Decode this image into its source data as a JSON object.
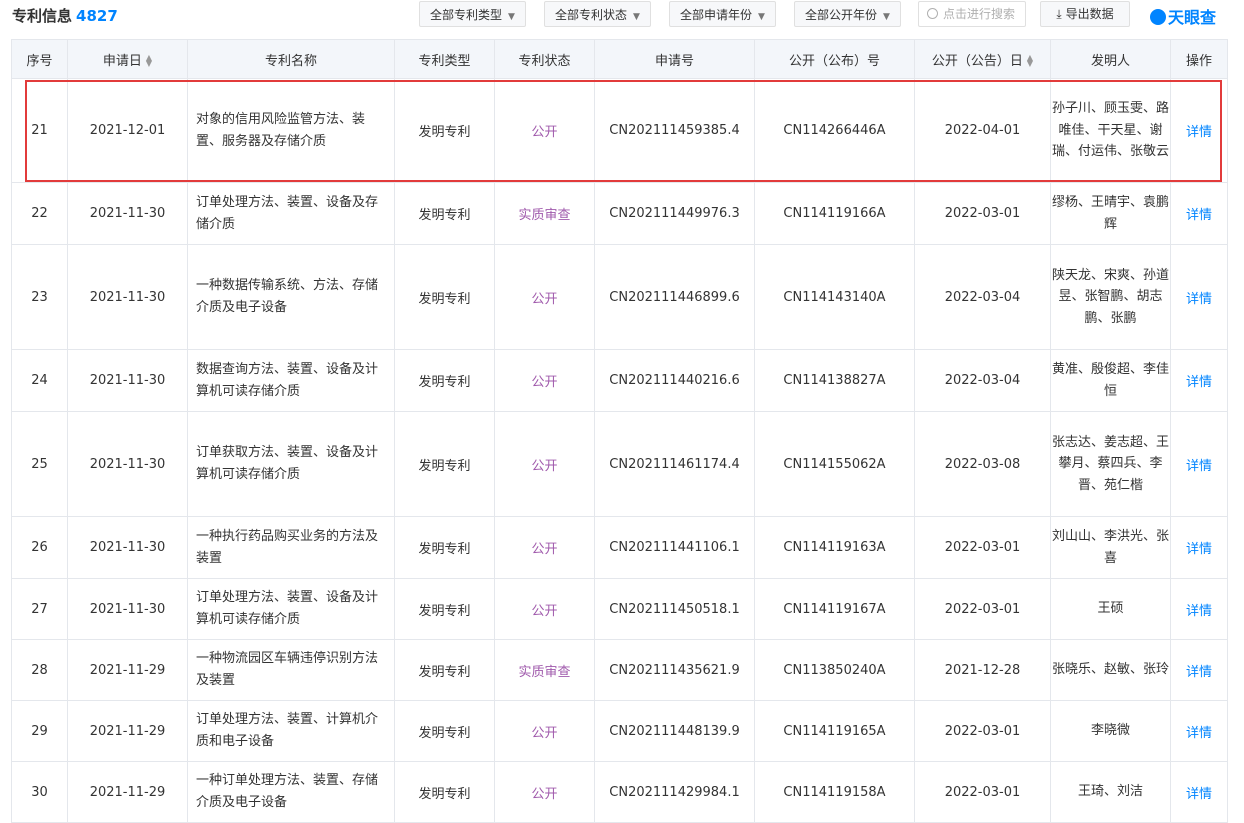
{
  "header": {
    "title": "专利信息",
    "count": "4827",
    "filters": [
      "全部专利类型",
      "全部专利状态",
      "全部申请年份",
      "全部公开年份"
    ],
    "search_placeholder": "点击进行搜索",
    "export_label": "导出数据",
    "logo_text": "天眼查"
  },
  "colors": {
    "accent": "#0084ff",
    "status": "#a05aac",
    "highlight": "#e23b3b"
  },
  "table": {
    "columns": [
      "序号",
      "申请日",
      "专利名称",
      "专利类型",
      "专利状态",
      "申请号",
      "公开（公布）号",
      "公开（公告）日",
      "发明人",
      "操作"
    ],
    "rows": [
      {
        "no": "21",
        "date": "2021-12-01",
        "name": "对象的信用风险监管方法、装置、服务器及存储介质",
        "type": "发明专利",
        "status": "公开",
        "app_no": "CN202111459385.4",
        "pub_no": "CN114266446A",
        "pub_date": "2022-04-01",
        "inventors": "孙子川、顾玉雯、路唯佳、干天星、谢瑞、付运伟、张敬云",
        "action": "详情"
      },
      {
        "no": "22",
        "date": "2021-11-30",
        "name": "订单处理方法、装置、设备及存储介质",
        "type": "发明专利",
        "status": "实质审查",
        "app_no": "CN202111449976.3",
        "pub_no": "CN114119166A",
        "pub_date": "2022-03-01",
        "inventors": "缪杨、王晴宇、袁鹏辉",
        "action": "详情"
      },
      {
        "no": "23",
        "date": "2021-11-30",
        "name": "一种数据传输系统、方法、存储介质及电子设备",
        "type": "发明专利",
        "status": "公开",
        "app_no": "CN202111446899.6",
        "pub_no": "CN114143140A",
        "pub_date": "2022-03-04",
        "inventors": "陕天龙、宋爽、孙道昱、张智鹏、胡志鹏、张鹏",
        "action": "详情"
      },
      {
        "no": "24",
        "date": "2021-11-30",
        "name": "数据查询方法、装置、设备及计算机可读存储介质",
        "type": "发明专利",
        "status": "公开",
        "app_no": "CN202111440216.6",
        "pub_no": "CN114138827A",
        "pub_date": "2022-03-04",
        "inventors": "黄准、殷俊超、李佳恒",
        "action": "详情"
      },
      {
        "no": "25",
        "date": "2021-11-30",
        "name": "订单获取方法、装置、设备及计算机可读存储介质",
        "type": "发明专利",
        "status": "公开",
        "app_no": "CN202111461174.4",
        "pub_no": "CN114155062A",
        "pub_date": "2022-03-08",
        "inventors": "张志达、姜志超、王攀月、蔡四兵、李晋、苑仁楷",
        "action": "详情"
      },
      {
        "no": "26",
        "date": "2021-11-30",
        "name": "一种执行药品购买业务的方法及装置",
        "type": "发明专利",
        "status": "公开",
        "app_no": "CN202111441106.1",
        "pub_no": "CN114119163A",
        "pub_date": "2022-03-01",
        "inventors": "刘山山、李洪光、张喜",
        "action": "详情"
      },
      {
        "no": "27",
        "date": "2021-11-30",
        "name": "订单处理方法、装置、设备及计算机可读存储介质",
        "type": "发明专利",
        "status": "公开",
        "app_no": "CN202111450518.1",
        "pub_no": "CN114119167A",
        "pub_date": "2022-03-01",
        "inventors": "王硕",
        "action": "详情"
      },
      {
        "no": "28",
        "date": "2021-11-29",
        "name": "一种物流园区车辆违停识别方法及装置",
        "type": "发明专利",
        "status": "实质审查",
        "app_no": "CN202111435621.9",
        "pub_no": "CN113850240A",
        "pub_date": "2021-12-28",
        "inventors": "张晓乐、赵敏、张玲",
        "action": "详情"
      },
      {
        "no": "29",
        "date": "2021-11-29",
        "name": "订单处理方法、装置、计算机介质和电子设备",
        "type": "发明专利",
        "status": "公开",
        "app_no": "CN202111448139.9",
        "pub_no": "CN114119165A",
        "pub_date": "2022-03-01",
        "inventors": "李晓微",
        "action": "详情"
      },
      {
        "no": "30",
        "date": "2021-11-29",
        "name": "一种订单处理方法、装置、存储介质及电子设备",
        "type": "发明专利",
        "status": "公开",
        "app_no": "CN202111429984.1",
        "pub_no": "CN114119158A",
        "pub_date": "2022-03-01",
        "inventors": "王琦、刘洁",
        "action": "详情"
      }
    ]
  }
}
